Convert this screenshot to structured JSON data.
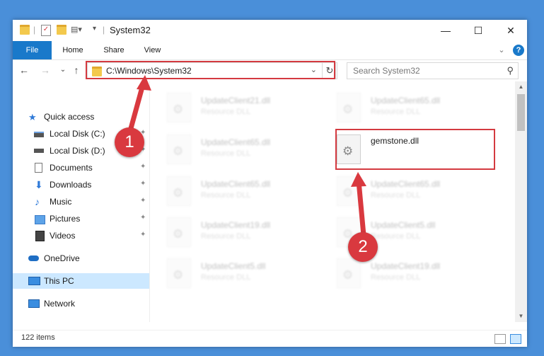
{
  "window": {
    "title": "System32"
  },
  "window_controls": {
    "minimize": "—",
    "maximize": "☐",
    "close": "✕"
  },
  "ribbon": {
    "tabs": [
      "File",
      "Home",
      "Share",
      "View"
    ],
    "expand": "⌄",
    "help": "?"
  },
  "address": {
    "path": "C:\\Windows\\System32",
    "search_placeholder": "Search System32",
    "back": "←",
    "forward": "→",
    "recent": "⌄",
    "up": "↑",
    "refresh": "↻"
  },
  "sidebar": {
    "quick_access": "Quick access",
    "items": [
      {
        "label": "Local Disk (C:)",
        "pinned": true,
        "icon": "drive-icon"
      },
      {
        "label": "Local Disk (D:)",
        "pinned": true,
        "icon": "drive-icon"
      },
      {
        "label": "Documents",
        "pinned": true,
        "icon": "documents-icon"
      },
      {
        "label": "Downloads",
        "pinned": true,
        "icon": "downloads-icon"
      },
      {
        "label": "Music",
        "pinned": true,
        "icon": "music-icon"
      },
      {
        "label": "Pictures",
        "pinned": true,
        "icon": "pictures-icon"
      },
      {
        "label": "Videos",
        "pinned": true,
        "icon": "videos-icon"
      }
    ],
    "onedrive": "OneDrive",
    "this_pc": "This PC",
    "network": "Network",
    "pin_glyph": "📌"
  },
  "files": [
    {
      "name": "UpdateClient21.dll",
      "type": "Resource DLL"
    },
    {
      "name": "UpdateClient65.dll",
      "type": "Resource DLL"
    },
    {
      "name": "UpdateClient65.dll",
      "type": "Resource DLL"
    },
    {
      "name": "gemstone.dll",
      "type": ""
    },
    {
      "name": "UpdateClient65.dll",
      "type": "Resource DLL"
    },
    {
      "name": "UpdateClient65.dll",
      "type": "Resource DLL"
    },
    {
      "name": "UpdateClient19.dll",
      "type": "Resource DLL"
    },
    {
      "name": "UpdateClient5.dll",
      "type": "Resource DLL"
    },
    {
      "name": "UpdateClient5.dll",
      "type": "Resource DLL"
    },
    {
      "name": "UpdateClient19.dll",
      "type": "Resource DLL"
    }
  ],
  "status": {
    "item_count": "122 items"
  },
  "annotations": {
    "marker_1": "1",
    "marker_2": "2",
    "highlight_color": "#d43a40"
  },
  "colors": {
    "accent": "#1979ca",
    "desktop": "#4a8fd9",
    "selected_nav": "#cce8ff"
  }
}
